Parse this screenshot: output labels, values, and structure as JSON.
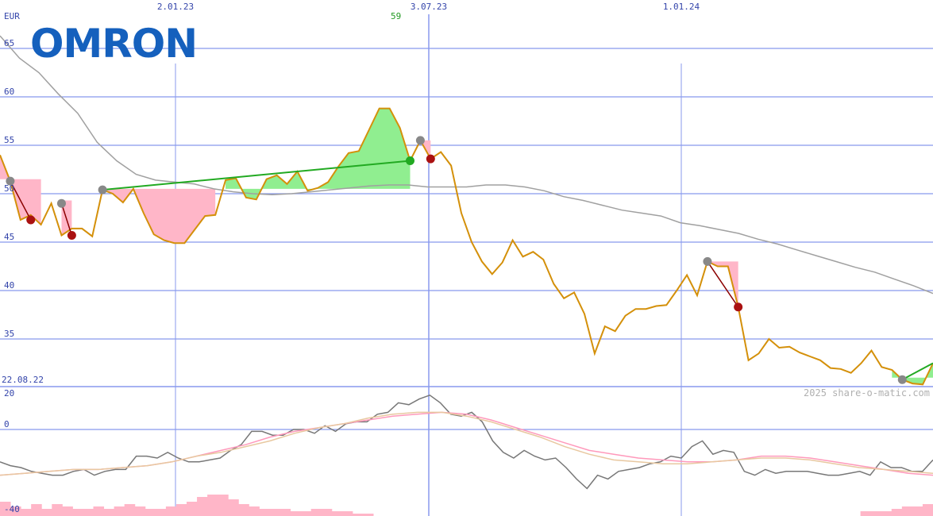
{
  "logo": {
    "text": "OMRON",
    "color": "#1560bd"
  },
  "currency": "EUR",
  "start_date_label": "22.08.22",
  "peak_label": "59",
  "watermark": "2025 share-o-matic.com",
  "colors": {
    "price": "#d4900a",
    "sma": "#a0a0a0",
    "grid": "#8899ee",
    "up_fill": "#90ee90",
    "down_fill": "#ffb6c8",
    "trend_up": "#22aa22",
    "trend_down": "#8b0000"
  },
  "chart_data": [
    {
      "type": "line",
      "ylabel": "EUR",
      "ylim": [
        22,
        68
      ],
      "y_ticks": [
        35,
        40,
        45,
        50,
        55,
        60,
        65
      ],
      "x_ticks": [
        "2.01.23",
        "3.07.23",
        "1.01.24"
      ],
      "series": [
        {
          "name": "price",
          "values": [
            54.0,
            51.3,
            47.3,
            47.8,
            46.8,
            49.0,
            45.7,
            46.4,
            46.4,
            45.6,
            50.4,
            50.0,
            49.1,
            50.5,
            48.0,
            45.8,
            45.2,
            44.9,
            44.9,
            46.3,
            47.7,
            47.8,
            51.4,
            51.6,
            49.6,
            49.4,
            51.5,
            51.9,
            51.0,
            52.3,
            50.3,
            50.6,
            51.2,
            52.8,
            54.2,
            54.4,
            56.6,
            58.8,
            58.8,
            56.8,
            53.4,
            55.5,
            53.6,
            54.3,
            52.9,
            48.0,
            45.0,
            43.0,
            41.7,
            42.9,
            45.2,
            43.5,
            44.0,
            43.2,
            40.7,
            39.2,
            39.8,
            37.6,
            33.5,
            36.3,
            35.8,
            37.4,
            38.1,
            38.1,
            38.4,
            38.5,
            40.0,
            41.6,
            39.5,
            43.0,
            42.5,
            42.5,
            38.3,
            32.8,
            33.5,
            35.0,
            34.1,
            34.2,
            33.6,
            33.2,
            32.8,
            32.0,
            31.9,
            31.5,
            32.5,
            33.8,
            32.1,
            31.8,
            30.8,
            30.4,
            30.3,
            32.5
          ]
        },
        {
          "name": "sma",
          "values": [
            66.3,
            64.0,
            62.5,
            60.3,
            58.3,
            55.3,
            53.4,
            52.0,
            51.4,
            51.2,
            51.0,
            50.5,
            50.2,
            50.0,
            49.9,
            50.0,
            50.2,
            50.4,
            50.6,
            50.8,
            50.9,
            50.9,
            50.7,
            50.7,
            50.7,
            50.9,
            50.9,
            50.7,
            50.3,
            49.7,
            49.3,
            48.8,
            48.3,
            48.0,
            47.7,
            47.0,
            46.7,
            46.3,
            45.9,
            45.3,
            44.8,
            44.2,
            43.6,
            43.0,
            42.4,
            41.9,
            41.2,
            40.5,
            39.7
          ]
        }
      ]
    },
    {
      "type": "line",
      "ylim": [
        -40,
        20
      ],
      "y_ticks": [
        20,
        0,
        -40
      ],
      "series": [
        {
          "name": "oscillator",
          "values": [
            -17,
            -19,
            -20,
            -22,
            -23,
            -24,
            -24,
            -22,
            -21,
            -24,
            -22,
            -21,
            -21,
            -14,
            -14,
            -15,
            -12,
            -15,
            -17,
            -17,
            -16,
            -15,
            -11,
            -8,
            -1,
            -1,
            -3,
            -3,
            0,
            0,
            -2,
            2,
            -1,
            3,
            4,
            4,
            8,
            9,
            14,
            13,
            16,
            18,
            14,
            8,
            7,
            9,
            4,
            -6,
            -12,
            -15,
            -11,
            -14,
            -16,
            -15,
            -20,
            -26,
            -31,
            -24,
            -26,
            -22,
            -21,
            -20,
            -18,
            -17,
            -14,
            -15,
            -9,
            -6,
            -13,
            -11,
            -12,
            -22,
            -24,
            -21,
            -23,
            -22,
            -22,
            -22,
            -23,
            -24,
            -24,
            -23,
            -22,
            -24,
            -17,
            -20,
            -20,
            -22,
            -22,
            -16
          ]
        },
        {
          "name": "signal_fast",
          "values": [
            -24,
            -23,
            -22,
            -21,
            -21,
            -20,
            -19,
            -17,
            -14,
            -11,
            -8,
            -4,
            -1,
            1,
            3,
            5,
            7,
            8,
            9,
            8,
            5,
            1,
            -3,
            -7,
            -11,
            -13,
            -15,
            -16,
            -17,
            -17,
            -16,
            -14,
            -14,
            -15,
            -17,
            -19,
            -21,
            -23,
            -24
          ]
        },
        {
          "name": "signal_slow",
          "values": [
            -24,
            -23,
            -22,
            -21,
            -21,
            -20,
            -19,
            -17,
            -14,
            -12,
            -9,
            -6,
            -2,
            1,
            3,
            6,
            8,
            9,
            9,
            7,
            4,
            0,
            -4,
            -9,
            -13,
            -16,
            -17,
            -18,
            -18,
            -17,
            -16,
            -15,
            -15,
            -16,
            -18,
            -20,
            -21,
            -22,
            -23
          ]
        },
        {
          "name": "volume",
          "values": [
            6,
            4,
            3,
            5,
            3,
            5,
            4,
            3,
            3,
            4,
            3,
            4,
            5,
            4,
            3,
            3,
            4,
            5,
            6,
            8,
            9,
            9,
            7,
            5,
            4,
            3,
            3,
            3,
            2,
            2,
            3,
            3,
            2,
            2,
            1,
            1,
            0,
            0,
            0,
            0,
            0,
            0,
            0,
            0,
            0,
            0,
            0,
            0,
            0,
            0,
            0,
            0,
            0,
            0,
            0,
            0,
            0,
            0,
            0,
            0,
            0,
            0,
            0,
            0,
            0,
            0,
            0,
            0,
            0,
            0,
            0,
            0,
            0,
            0,
            0,
            0,
            0,
            0,
            0,
            0,
            0,
            0,
            0,
            2,
            2,
            2,
            3,
            4,
            4,
            5
          ]
        }
      ]
    }
  ]
}
